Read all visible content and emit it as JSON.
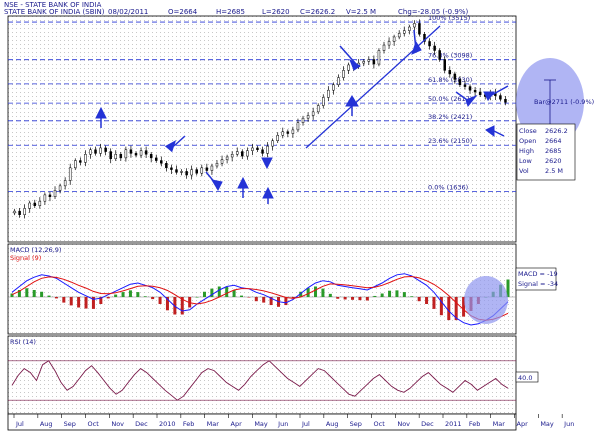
{
  "header": {
    "exchange_name": "NSE - STATE BANK OF INDIA",
    "symbol_name": "STATE BANK OF INDIA (SBIN)",
    "date": "08/02/2011",
    "open": "O=2664",
    "high": "H=2685",
    "low": "L=2620",
    "close": "C=2626.2",
    "volume": "V=2.5 M",
    "change": "Chg=-28.05 (-0.9%)"
  },
  "chart_data": [
    {
      "type": "candlestick",
      "panel": "price",
      "ylim": [
        1100,
        3560
      ],
      "series": [
        {
          "name": "SBIN",
          "values": [
            1420,
            1380,
            1450,
            1510,
            1480,
            1530,
            1600,
            1580,
            1650,
            1700,
            1760,
            1900,
            1980,
            1960,
            2050,
            2100,
            2060,
            2120,
            2080,
            2000,
            2050,
            2010,
            2100,
            2060,
            2040,
            2090,
            2050,
            2010,
            1980,
            1950,
            1900,
            1880,
            1850,
            1860,
            1820,
            1880,
            1840,
            1900,
            1870,
            1920,
            1950,
            1990,
            2020,
            2050,
            2080,
            2030,
            2090,
            2120,
            2100,
            2060,
            2140,
            2200,
            2260,
            2300,
            2280,
            2320,
            2400,
            2450,
            2480,
            2520,
            2590,
            2680,
            2760,
            2820,
            2900,
            2980,
            3040,
            3020,
            3060,
            3080,
            3100,
            3050,
            3200,
            3260,
            3300,
            3350,
            3390,
            3420,
            3460,
            3500,
            3380,
            3300,
            3250,
            3200,
            3100,
            2980,
            2940,
            2880,
            2820,
            2800,
            2760,
            2740,
            2710,
            2690,
            2730,
            2700,
            2660,
            2626
          ]
        }
      ],
      "fibonacci_levels": [
        {
          "label": "100% (3515)",
          "value": 3515
        },
        {
          "label": "76.8% (3098)",
          "value": 3098
        },
        {
          "label": "61.8% (2830)",
          "value": 2830
        },
        {
          "label": "50.0% (2617)",
          "value": 2617
        },
        {
          "label": "38.2% (2421)",
          "value": 2421
        },
        {
          "label": "23.6% (2150)",
          "value": 2150
        },
        {
          "label": "0.0% (1636)",
          "value": 1636
        }
      ],
      "crosshair_label": "Bar@2711 (-0.9%)",
      "info_box": [
        {
          "label": "Close",
          "value": "2626.2"
        },
        {
          "label": "Open",
          "value": "2664"
        },
        {
          "label": "High",
          "value": "2685"
        },
        {
          "label": "Low",
          "value": "2620"
        },
        {
          "label": "Vol",
          "value": "2.5 M"
        }
      ],
      "annotations": {
        "arrow_color": "#2433d6",
        "trendline_color": "#2433d6",
        "circle_fill": "#8f95ef"
      }
    },
    {
      "type": "histogram_line",
      "panel": "macd",
      "title": "MACD (12,26,9)",
      "legend": "Signal (9)",
      "ylim": [
        -150,
        150
      ],
      "series": [
        {
          "name": "MACD",
          "color": "#1a1aff",
          "values": [
            20,
            45,
            70,
            85,
            95,
            90,
            80,
            60,
            40,
            20,
            5,
            -10,
            -5,
            10,
            25,
            40,
            55,
            60,
            50,
            40,
            20,
            -10,
            -40,
            -60,
            -55,
            -30,
            -10,
            10,
            30,
            45,
            50,
            40,
            35,
            20,
            10,
            -5,
            -20,
            -25,
            -10,
            15,
            40,
            60,
            70,
            65,
            50,
            45,
            40,
            35,
            30,
            45,
            60,
            80,
            95,
            100,
            90,
            70,
            50,
            20,
            -20,
            -60,
            -90,
            -110,
            -120,
            -115,
            -100,
            -80,
            -50,
            -20
          ]
        },
        {
          "name": "Signal",
          "color": "#e01010",
          "values": [
            10,
            25,
            45,
            65,
            80,
            86,
            84,
            76,
            64,
            50,
            38,
            24,
            15,
            14,
            18,
            26,
            36,
            46,
            48,
            46,
            40,
            28,
            10,
            -10,
            -25,
            -30,
            -25,
            -14,
            0,
            16,
            30,
            36,
            36,
            32,
            26,
            18,
            8,
            -2,
            -6,
            0,
            14,
            30,
            46,
            56,
            55,
            52,
            48,
            44,
            40,
            42,
            50,
            62,
            76,
            86,
            88,
            82,
            70,
            54,
            32,
            6,
            -24,
            -54,
            -80,
            -95,
            -100,
            -95,
            -85,
            -70
          ]
        }
      ],
      "value_label": "MACD = -19",
      "signal_label": "Signal = -34"
    },
    {
      "type": "line",
      "panel": "rsi",
      "title": "RSI (14)",
      "ylim": [
        20,
        85
      ],
      "reference_lines": [
        70,
        30
      ],
      "series": [
        {
          "name": "RSI",
          "color": "#7a1a4a",
          "values": [
            45,
            55,
            62,
            58,
            50,
            66,
            70,
            60,
            48,
            40,
            44,
            52,
            60,
            65,
            58,
            50,
            42,
            36,
            40,
            48,
            56,
            62,
            58,
            52,
            46,
            40,
            35,
            30,
            34,
            42,
            50,
            58,
            62,
            60,
            54,
            48,
            44,
            40,
            46,
            54,
            60,
            66,
            70,
            64,
            58,
            52,
            48,
            44,
            50,
            56,
            62,
            60,
            54,
            48,
            42,
            36,
            34,
            40,
            46,
            52,
            56,
            50,
            44,
            40,
            38,
            42,
            48,
            54,
            58,
            52,
            46,
            42,
            38,
            44,
            50,
            46,
            40,
            44,
            48,
            52,
            46,
            42
          ]
        }
      ],
      "value_label": "40.0"
    }
  ],
  "x_axis": {
    "months": [
      "Jul",
      "Aug",
      "Sep",
      "Oct",
      "Nov",
      "Dec",
      "2010",
      "Feb",
      "Mar",
      "Apr",
      "May",
      "Jun",
      "Jul",
      "Aug",
      "Sep",
      "Oct",
      "Nov",
      "Dec",
      "2011",
      "Feb",
      "Mar",
      "Apr",
      "May",
      "Jun"
    ]
  }
}
